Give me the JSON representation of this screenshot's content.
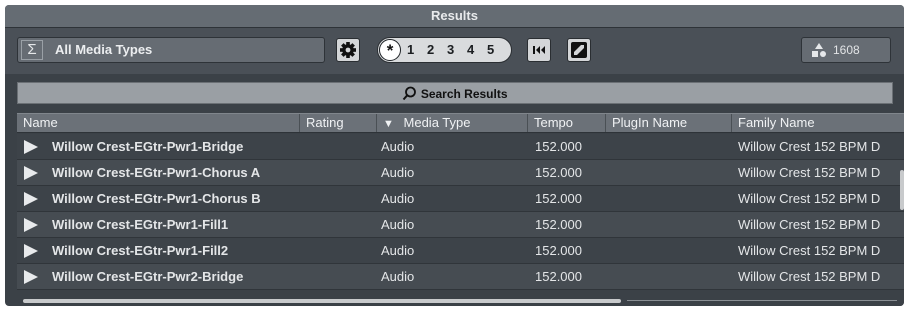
{
  "window": {
    "title": "Results"
  },
  "toolbar": {
    "media_type_symbol": "Σ",
    "media_type_label": "All Media Types",
    "settings_icon": "gear-icon",
    "rating_filter": {
      "star": "*",
      "options": [
        "1",
        "2",
        "3",
        "4",
        "5"
      ]
    },
    "rewind_icon": "go-to-start-icon",
    "sync_icon": "sync-selection-icon",
    "result_count_icon": "shapes-icon",
    "result_count": "1608"
  },
  "search": {
    "label": "Search Results",
    "icon": "search-icon"
  },
  "columns": [
    {
      "label": "Name"
    },
    {
      "label": "Rating"
    },
    {
      "label": "Media Type",
      "sort_indicator": "▼"
    },
    {
      "label": "Tempo"
    },
    {
      "label": "PlugIn Name"
    },
    {
      "label": "Family Name"
    }
  ],
  "rows": [
    {
      "name": "Willow Crest-EGtr-Pwr1-Bridge",
      "rating": "",
      "media_type": "Audio",
      "tempo": "152.000",
      "plugin_name": "",
      "family_name": "Willow Crest 152 BPM D"
    },
    {
      "name": "Willow Crest-EGtr-Pwr1-Chorus A",
      "rating": "",
      "media_type": "Audio",
      "tempo": "152.000",
      "plugin_name": "",
      "family_name": "Willow Crest 152 BPM D"
    },
    {
      "name": "Willow Crest-EGtr-Pwr1-Chorus B",
      "rating": "",
      "media_type": "Audio",
      "tempo": "152.000",
      "plugin_name": "",
      "family_name": "Willow Crest 152 BPM D"
    },
    {
      "name": "Willow Crest-EGtr-Pwr1-Fill1",
      "rating": "",
      "media_type": "Audio",
      "tempo": "152.000",
      "plugin_name": "",
      "family_name": "Willow Crest 152 BPM D"
    },
    {
      "name": "Willow Crest-EGtr-Pwr1-Fill2",
      "rating": "",
      "media_type": "Audio",
      "tempo": "152.000",
      "plugin_name": "",
      "family_name": "Willow Crest 152 BPM D"
    },
    {
      "name": "Willow Crest-EGtr-Pwr2-Bridge",
      "rating": "",
      "media_type": "Audio",
      "tempo": "152.000",
      "plugin_name": "",
      "family_name": "Willow Crest 152 BPM D"
    }
  ],
  "colors": {
    "panel_bg": "#3b4147",
    "title_bar": "#656c73",
    "row_bg": "#3d4349",
    "row_alt_bg": "#464c52",
    "text": "#e4e6e8"
  }
}
